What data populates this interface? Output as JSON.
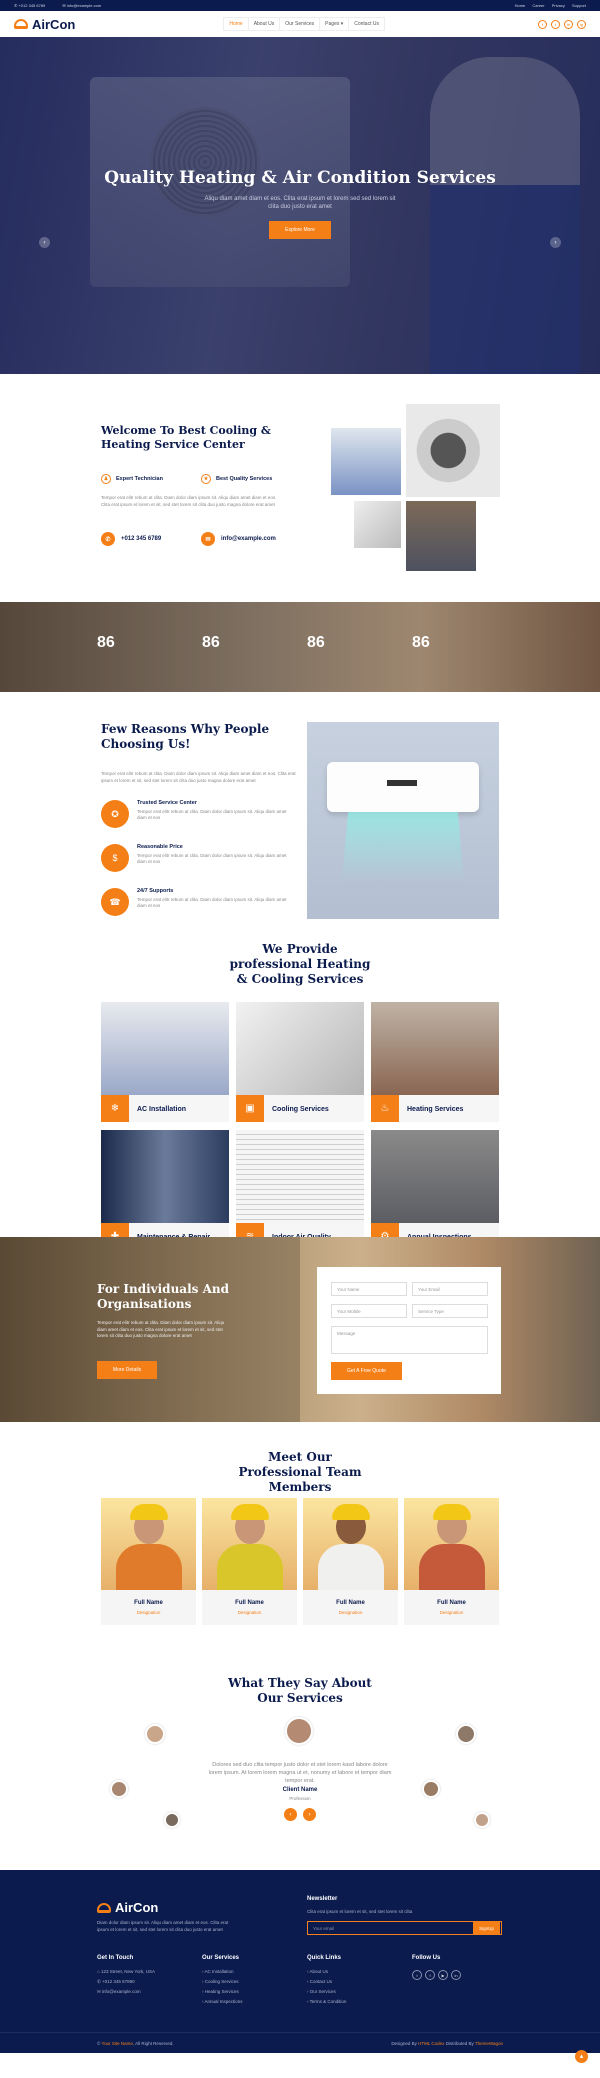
{
  "topbar": {
    "phone": "+012 345 6789",
    "email": "info@example.com",
    "links": [
      "Home",
      "Career",
      "Privacy",
      "Support"
    ]
  },
  "nav": {
    "brand": "AirCon",
    "items": [
      "Home",
      "About Us",
      "Our Services",
      "Pages ▾",
      "Contact Us"
    ],
    "social": [
      "f",
      "t",
      "in",
      "ig"
    ]
  },
  "hero": {
    "title": "Quality Heating & Air Condition Services",
    "text": "Aliqu diam amet diam et eos. Clita erat ipsum et lorem sed sed lorem sit clita duo justo erat amet",
    "button": "Explore More"
  },
  "welcome": {
    "title": "Welcome To Best Cooling & Heating Service Center",
    "feat1": "Expert Technician",
    "feat2": "Best Quality Services",
    "text": "Tempor erat elitr rebum at clita. Diam dolor diam ipsum sit. Aliqu diam amet diam et eos. Clita erat ipsum et lorem et sit, sed stet lorem sit clita duo justo magna dolore erat amet",
    "phone": "+012 345 6789",
    "email": "info@example.com"
  },
  "counters": [
    "86",
    "86",
    "86",
    "86"
  ],
  "reasons": {
    "title": "Few Reasons Why People Choosing Us!",
    "text": "Tempor erat elitr rebum at clita. Diam dolor diam ipsum sit. Aliqu diam amet diam et eos. Clita erat ipsum et lorem et sit, sed stet lorem sit clita duo justo magna dolore erat amet",
    "items": [
      {
        "title": "Trusted Service Center",
        "text": "Tempor erat elitr rebum at clita. Diam dolor diam ipsum sit. Aliqu diam amet diam et eos"
      },
      {
        "title": "Reasonable Price",
        "text": "Tempor erat elitr rebum at clita. Diam dolor diam ipsum sit. Aliqu diam amet diam et eos"
      },
      {
        "title": "24/7 Supports",
        "text": "Tempor erat elitr rebum at clita. Diam dolor diam ipsum sit. Aliqu diam amet diam et eos"
      }
    ]
  },
  "services": {
    "title": "We Provide professional Heating & Cooling Services",
    "items": [
      "AC Installation",
      "Cooling Services",
      "Heating Services",
      "Maintenance & Repair",
      "Indoor Air Quality",
      "Annual Inspections"
    ]
  },
  "quote": {
    "title": "For Individuals And Organisations",
    "text": "Tempor erat elitr rebum at clita. Diam dolor diam ipsum sit. Aliqu diam amet diam et eos. Clita erat ipsum et lorem et sit, sed stet lorem sit clita duo justo magna dolore erat amet",
    "button": "More Details",
    "name": "Your Name",
    "email": "Your Email",
    "mobile": "Your Mobile",
    "type": "Service Type",
    "message": "Message",
    "submit": "Get A Free Quote"
  },
  "team": {
    "title": "Meet Our Professional Team Members",
    "members": [
      {
        "name": "Full Name",
        "role": "Designation"
      },
      {
        "name": "Full Name",
        "role": "Designation"
      },
      {
        "name": "Full Name",
        "role": "Designation"
      },
      {
        "name": "Full Name",
        "role": "Designation"
      }
    ]
  },
  "testimonial": {
    "title": "What They Say About Our Services",
    "quote": "Dolores sed duo clita tempor justo dolor et stet lorem kasd labore dolore lorem ipsum. At lorem lorem magna ut et, nonumy et labore et tempor diam tempor erat.",
    "name": "Client Name",
    "role": "Profession",
    "prev": "‹",
    "next": "›"
  },
  "footer": {
    "brand": "AirCon",
    "about": "Diam dolor diam ipsum sit. Aliqu diam amet diam et eos. Clita erat ipsum et lorem et sit, sed stet lorem sit clita duo justo erat amet",
    "newsletter": "Newsletter",
    "nl_text": "Clita erat ipsum et lorem et sit, sed stet lorem sit clita",
    "nl_placeholder": "Your email",
    "nl_button": "SignUp",
    "touch": "Get In Touch",
    "address": "123 Street, New York, USA",
    "phone": "+012 345 67890",
    "email": "info@example.com",
    "services_title": "Our Services",
    "services": [
      "AC Installation",
      "Cooling Services",
      "Heating Services",
      "Annual Inspections"
    ],
    "links_title": "Quick Links",
    "links": [
      "About Us",
      "Contact Us",
      "Our Services",
      "Terms & Condition"
    ],
    "follow": "Follow Us",
    "copy_pre": "©",
    "site": "Your Site Name",
    "copy_post": ", All Right Reserved.",
    "design_pre": "Designed By",
    "design_by": "HTML Codex",
    "dist_pre": "Distributed By",
    "dist_by": "ThemeWagon"
  },
  "icons": {
    "phone": "phone-icon",
    "email": "envelope-icon",
    "up": "arrow-up-icon"
  },
  "colors": {
    "accent": "#f57f17",
    "navy": "#0b1b4d"
  }
}
